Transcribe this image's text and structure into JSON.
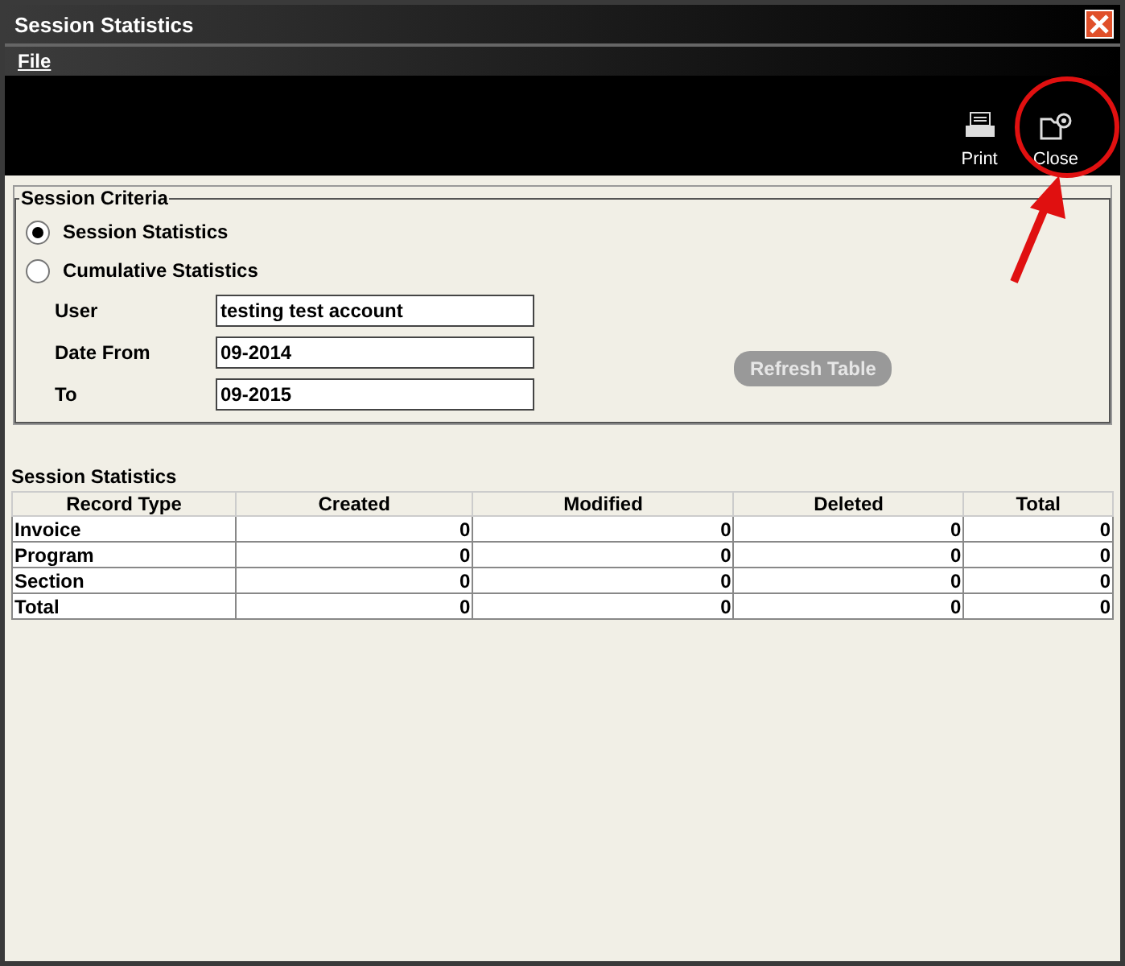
{
  "window": {
    "title": "Session Statistics"
  },
  "menu": [
    {
      "label": "File"
    }
  ],
  "toolbar": [
    {
      "kind": "print",
      "label": "Print"
    },
    {
      "kind": "close",
      "label": "Close"
    }
  ],
  "criteria": {
    "title": "Session Criteria",
    "modes": [
      {
        "label": "Session Statistics",
        "selected": true
      },
      {
        "label": "Cumulative Statistics",
        "selected": false
      }
    ],
    "fields": [
      {
        "label": "User",
        "value": "testing test account"
      },
      {
        "label": "Date From",
        "value": "09-2014"
      },
      {
        "label": "To",
        "value": "09-2015"
      }
    ],
    "refresh_button": {
      "label": "Refresh Table",
      "disabled": true
    }
  },
  "table": {
    "title": "Session Statistics",
    "columns": [
      "Record Type",
      "Created",
      "Modified",
      "Deleted",
      "Total"
    ],
    "rows": [
      [
        "Invoice",
        "0",
        "0",
        "0",
        "0"
      ],
      [
        "Program",
        "0",
        "0",
        "0",
        "0"
      ],
      [
        "Section",
        "0",
        "0",
        "0",
        "0"
      ],
      [
        "Total",
        "0",
        "0",
        "0",
        "0"
      ]
    ]
  },
  "highlight": {
    "circle": true,
    "arrow": true
  }
}
